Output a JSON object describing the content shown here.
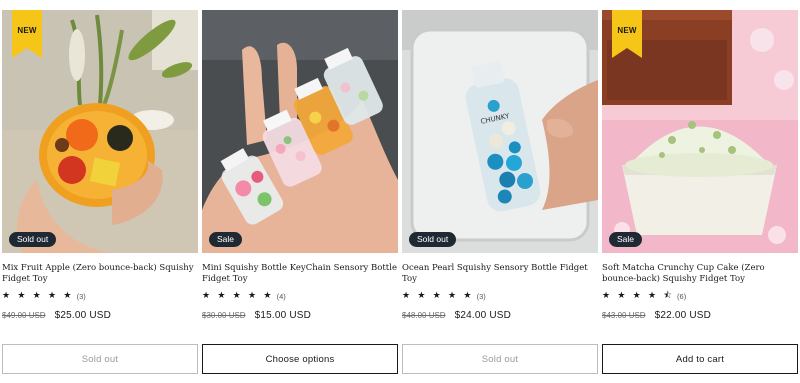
{
  "products": [
    {
      "title": "Mix Fruit Apple (Zero bounce-back) Squishy Fidget Toy",
      "image_alt": "Clear apple-shaped squishy with fruit pieces held in hand",
      "badge_new": "NEW",
      "status": "Sold out",
      "rating_stars": "★ ★ ★ ★ ★",
      "rating": 5,
      "review_count": "(3)",
      "compare_price": "$49.00 USD",
      "price": "$25.00 USD",
      "button_label": "Sold out",
      "button_enabled": false
    },
    {
      "title": "Mini Squishy Bottle KeyChain Sensory Bottle Fidget Toy",
      "image_alt": "Four mini squishy bottles held in palm",
      "status": "Sale",
      "rating_stars": "★ ★ ★ ★ ★",
      "rating": 5,
      "review_count": "(4)",
      "compare_price": "$30.00 USD",
      "price": "$15.00 USD",
      "button_label": "Choose options",
      "button_enabled": true
    },
    {
      "title": "Ocean Pearl Squishy Sensory Bottle Fidget Toy",
      "image_alt": "Bottle with blue pearls held over sink",
      "status": "Sold out",
      "rating_stars": "★ ★ ★ ★ ★",
      "rating": 5,
      "review_count": "(3)",
      "compare_price": "$48.00 USD",
      "price": "$24.00 USD",
      "button_label": "Sold out",
      "button_enabled": false
    },
    {
      "title": "Soft Matcha Crunchy Cup Cake (Zero bounce-back) Squishy Fidget Toy",
      "image_alt": "Matcha cupcake squishy on pink table",
      "badge_new": "NEW",
      "status": "Sale",
      "rating_stars": "★ ★ ★ ★ ⯪",
      "rating": 4.5,
      "review_count": "(6)",
      "compare_price": "$43.00 USD",
      "price": "$22.00 USD",
      "button_label": "Add to cart",
      "button_enabled": true
    }
  ],
  "colors": {
    "pill_bg": "#1f2933",
    "badge_new": "#f5c518",
    "button_border": "#1a1a1a",
    "disabled_border": "#bdbdbd"
  }
}
